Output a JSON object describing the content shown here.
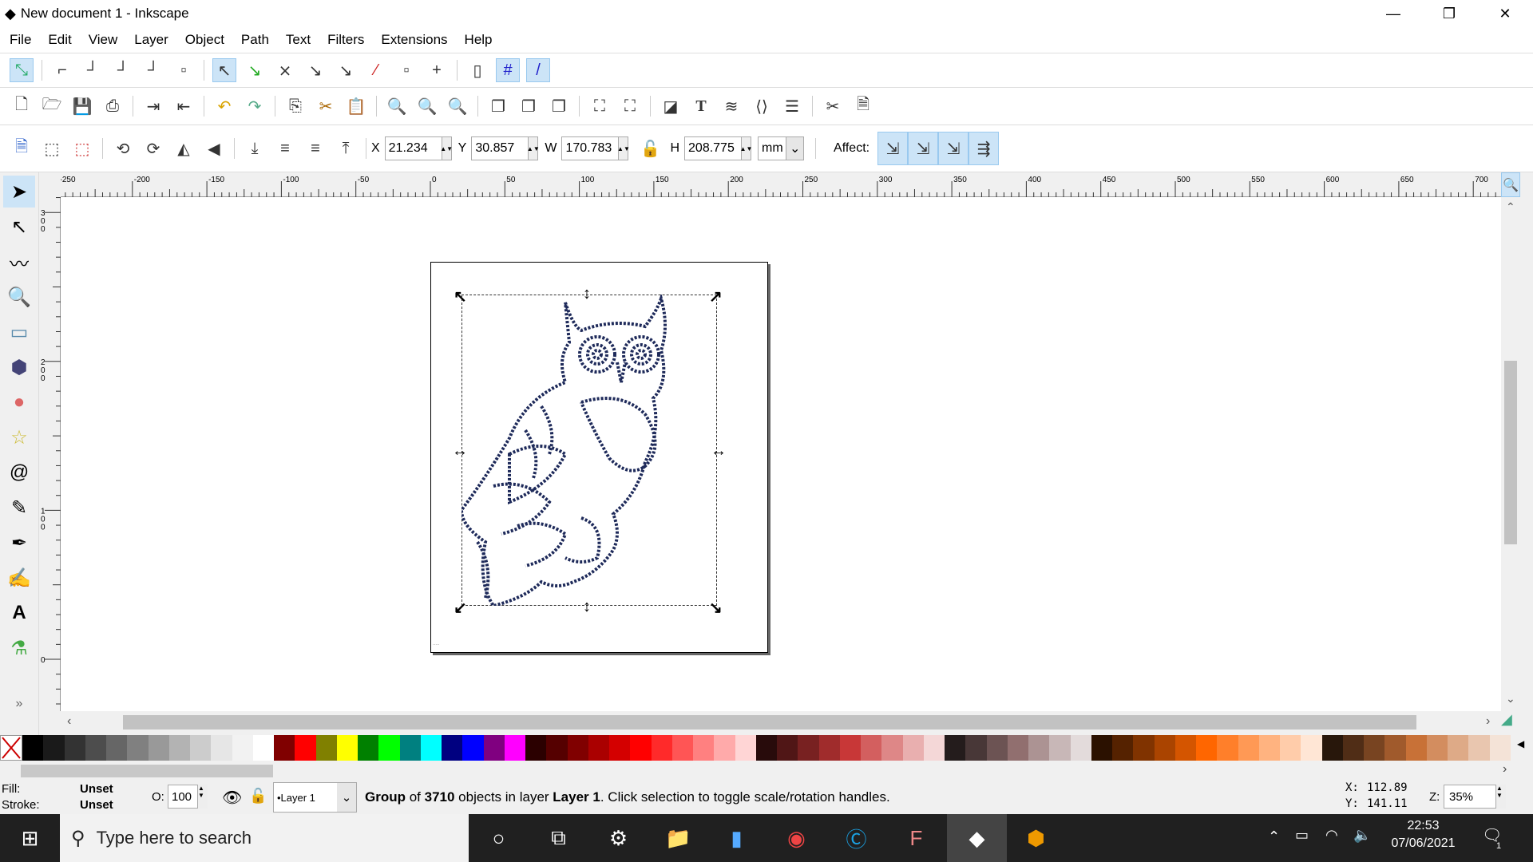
{
  "window": {
    "title": "New document 1 - Inkscape",
    "minimize": "—",
    "restore": "❐",
    "close": "✕"
  },
  "menu": [
    "File",
    "Edit",
    "View",
    "Layer",
    "Object",
    "Path",
    "Text",
    "Filters",
    "Extensions",
    "Help"
  ],
  "select_toolbar": {
    "x_label": "X",
    "x": "21.234",
    "y_label": "Y",
    "y": "30.857",
    "w_label": "W",
    "w": "170.783",
    "h_label": "H",
    "h": "208.775",
    "unit": "mm",
    "affect_label": "Affect:"
  },
  "hruler_labels": [
    "-250",
    "-200",
    "-150",
    "-100",
    "-50",
    "0",
    "50",
    "100",
    "150",
    "200",
    "250",
    "300",
    "350",
    "400",
    "450",
    "500",
    "550",
    "600",
    "650",
    "700"
  ],
  "vruler_labels": [
    "300",
    "200",
    "100",
    "0"
  ],
  "palette": [
    "#000000",
    "#1a1a1a",
    "#333333",
    "#4d4d4d",
    "#666666",
    "#808080",
    "#999999",
    "#b3b3b3",
    "#cccccc",
    "#e6e6e6",
    "#f2f2f2",
    "#ffffff",
    "#800000",
    "#ff0000",
    "#808000",
    "#ffff00",
    "#008000",
    "#00ff00",
    "#008080",
    "#00ffff",
    "#000080",
    "#0000ff",
    "#800080",
    "#ff00ff",
    "#2b0000",
    "#550000",
    "#800000",
    "#aa0000",
    "#d40000",
    "#ff0000",
    "#ff2a2a",
    "#ff5555",
    "#ff8080",
    "#ffaaaa",
    "#ffd5d5",
    "#280b0b",
    "#501616",
    "#782121",
    "#a02c2c",
    "#c83737",
    "#d35f5f",
    "#de8787",
    "#e9afaf",
    "#f4d7d7",
    "#241c1c",
    "#483737",
    "#6c5353",
    "#916f6f",
    "#ac9393",
    "#c8b7b7",
    "#e3dbdb",
    "#2b1100",
    "#552200",
    "#803300",
    "#aa4400",
    "#d45500",
    "#ff6600",
    "#ff7f2a",
    "#ff9955",
    "#ffb380",
    "#ffccaa",
    "#ffe6d5",
    "#28170b",
    "#502d16",
    "#784421",
    "#a05a2c",
    "#c87137",
    "#d38d5f",
    "#deaa87",
    "#e9c6af",
    "#f4e3d7"
  ],
  "status": {
    "fill_label": "Fill:",
    "fill": "Unset",
    "stroke_label": "Stroke:",
    "stroke": "Unset",
    "opacity_label": "O:",
    "opacity": "100",
    "layer": "•Layer 1",
    "message_pre": "Group",
    "message_mid1": " of ",
    "count": "3710",
    "message_mid2": " objects in layer ",
    "layer_name": "Layer 1",
    "message_post": ". Click selection to toggle scale/rotation handles.",
    "x_label": "X:",
    "cursor_x": "112.89",
    "y_label": "Y:",
    "cursor_y": "141.11",
    "zoom_label": "Z:",
    "zoom": "35%"
  },
  "taskbar": {
    "search_placeholder": "Type here to search",
    "time": "22:53",
    "date": "07/06/2021",
    "notifications": "1"
  }
}
